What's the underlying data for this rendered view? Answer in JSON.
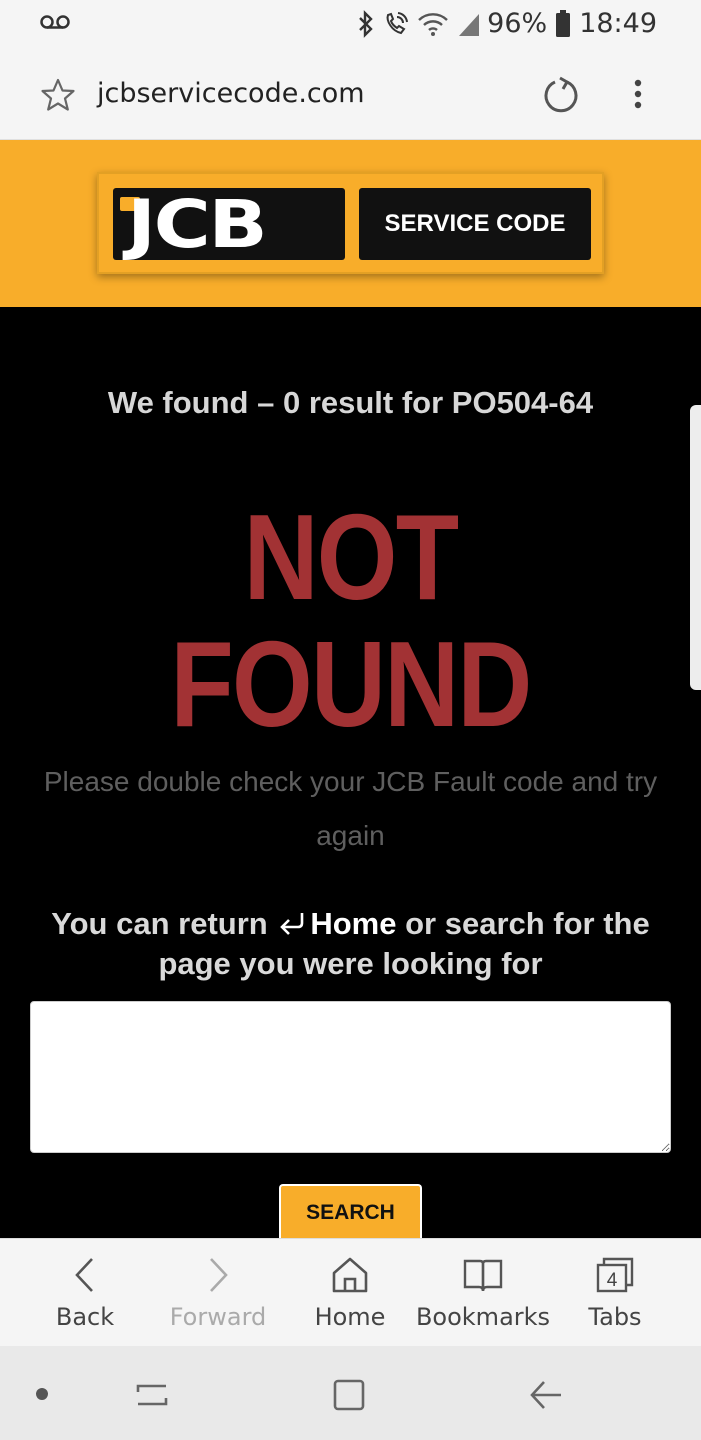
{
  "status_bar": {
    "battery_percent": "96%",
    "time": "18:49"
  },
  "address_bar": {
    "url": "jcbservicecode.com"
  },
  "logo": {
    "brand": "JCB",
    "tagline": "SERVICE CODE"
  },
  "result": {
    "found_text": "We found – 0 result for PO504-64",
    "not_text": "NOT",
    "found_big_text": "FOUND",
    "message": "Please double check your JCB Fault code and try again",
    "return_prefix": "You can return",
    "home_link": "Home",
    "return_suffix": "or search for the page you were looking for"
  },
  "search": {
    "value": "",
    "placeholder": "",
    "button_label": "SEARCH"
  },
  "toolbar": {
    "back": "Back",
    "forward": "Forward",
    "home": "Home",
    "bookmarks": "Bookmarks",
    "tabs": "Tabs",
    "tab_count": "4"
  },
  "colors": {
    "brand_yellow": "#f8ad2a",
    "not_found_red": "#a23234"
  }
}
